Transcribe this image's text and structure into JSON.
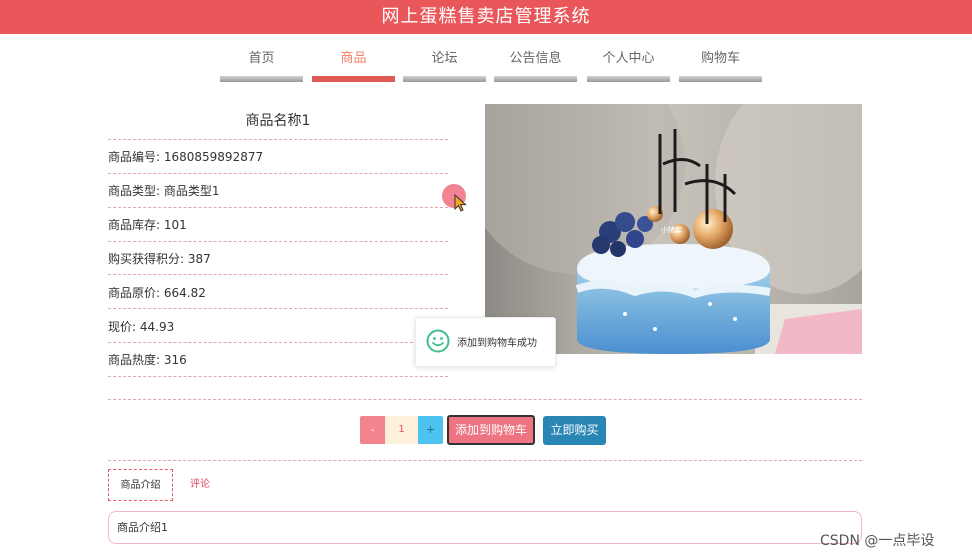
{
  "app": {
    "title": "网上蛋糕售卖店管理系统"
  },
  "nav": {
    "items": [
      {
        "label": "首页",
        "active": false
      },
      {
        "label": "商品",
        "active": true
      },
      {
        "label": "论坛",
        "active": false
      },
      {
        "label": "公告信息",
        "active": false
      },
      {
        "label": "个人中心",
        "active": false
      },
      {
        "label": "购物车",
        "active": false
      }
    ]
  },
  "product": {
    "name": "商品名称1",
    "fields": [
      {
        "label": "商品编号: 1680859892877"
      },
      {
        "label": "商品类型: 商品类型1"
      },
      {
        "label": "商品库存: 101"
      },
      {
        "label": "购买获得积分: 387"
      },
      {
        "label": "商品原价: 664.82"
      },
      {
        "label": "现价: 44.93"
      },
      {
        "label": "商品热度: 316"
      }
    ],
    "image_text": "小猪套"
  },
  "toast": {
    "message": "添加到购物车成功",
    "icon": "smile-icon"
  },
  "actions": {
    "minus": "-",
    "quantity": "1",
    "plus": "+",
    "add_to_cart": "添加到购物车",
    "buy_now": "立即购买"
  },
  "tabs": [
    {
      "label": "商品介绍",
      "active": true
    },
    {
      "label": "评论",
      "active": false
    }
  ],
  "intro": {
    "text": "商品介绍1"
  },
  "watermark": "CSDN @一点毕设",
  "colors": {
    "header": "#e9575a",
    "nav_active": "#e05a56",
    "add_to_cart": "#ee7481",
    "buy_now": "#2a87b5",
    "qty_plus": "#4ec3ef",
    "qty_minus": "#f3838d"
  }
}
